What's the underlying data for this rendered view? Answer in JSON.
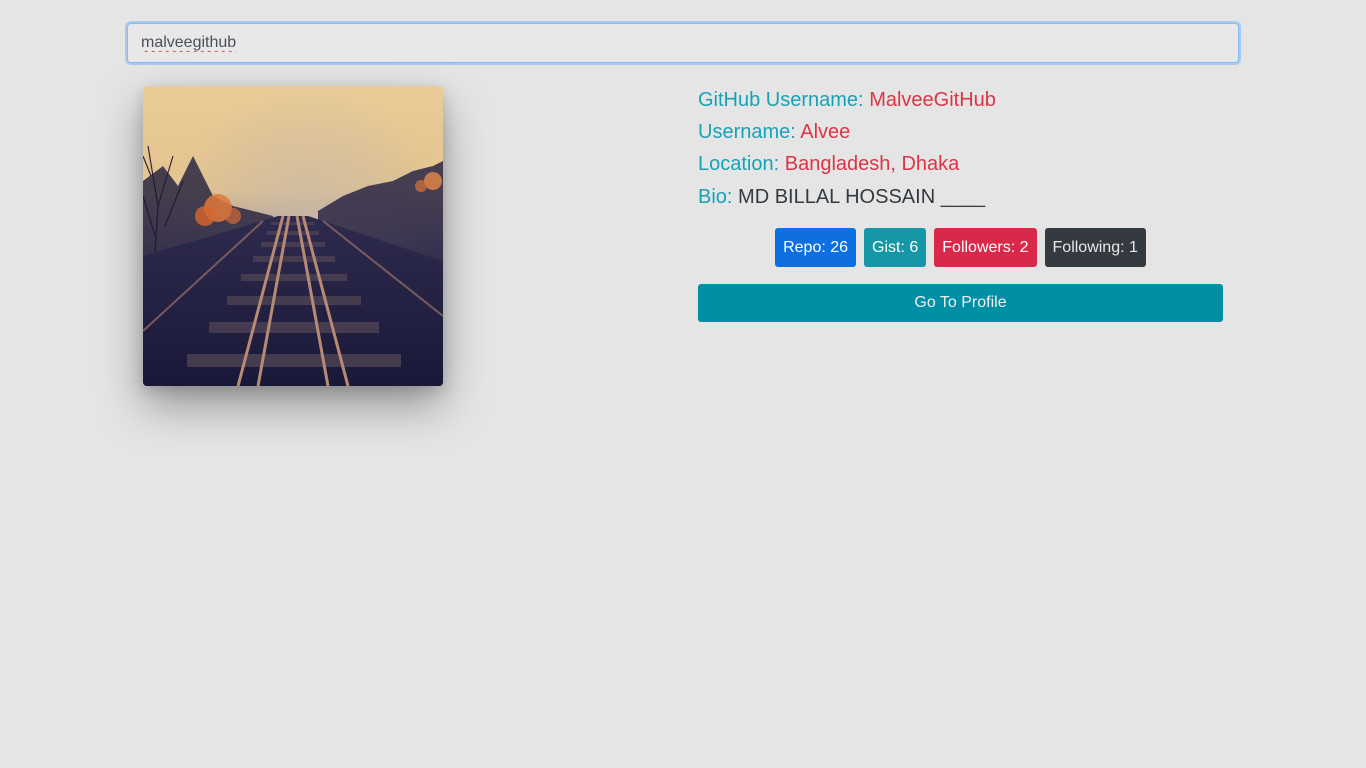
{
  "search": {
    "value": "malveegithub"
  },
  "avatar": {
    "alt": "railway tracks"
  },
  "profile": {
    "github_username_label": "GitHub Username:",
    "github_username": "MalveeGitHub",
    "username_label": "Username:",
    "username": "Alvee",
    "location_label": "Location:",
    "location": "Bangladesh, Dhaka",
    "bio_label": "Bio:",
    "bio": "MD BILLAL HOSSAIN ____"
  },
  "stats": {
    "repo": "Repo: 26",
    "gist": "Gist: 6",
    "followers": "Followers: 2",
    "following": "Following: 1"
  },
  "actions": {
    "go_to_profile": "Go To Profile"
  },
  "colors": {
    "label": "#17a2b8",
    "value": "#dc3545",
    "repo_badge": "#0d6fe0",
    "gist_badge": "#1597a8",
    "followers_badge": "#d9284a",
    "following_badge": "#343a40",
    "profile_button": "#0090a6"
  }
}
